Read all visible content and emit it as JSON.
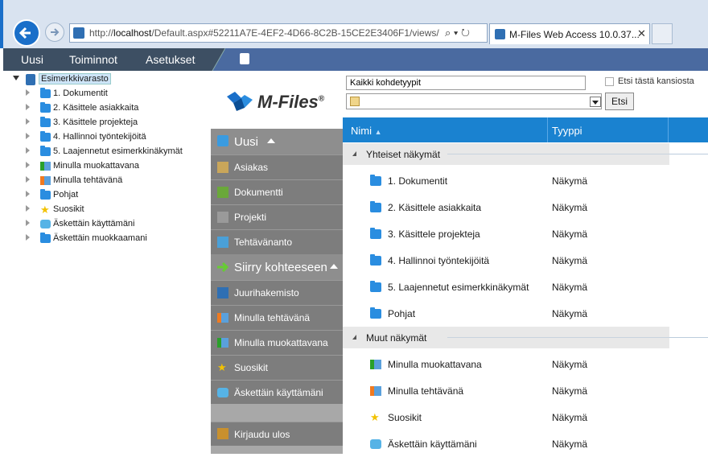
{
  "browser": {
    "address_prefix": "http://",
    "address_host": "localhost",
    "address_rest": "/Default.aspx#52211A7E-4EF2-4D66-8C2B-15CE2E3406F1/views/",
    "address_controls": "⌕ ▾ ↻",
    "tab_title": "M-Files Web Access 10.0.37...",
    "tab_close": "✕"
  },
  "menubar": {
    "items": [
      "Uusi",
      "Toiminnot",
      "Asetukset"
    ]
  },
  "tree": {
    "root": "Esimerkkivarasto",
    "items": [
      {
        "label": "1. Dokumentit",
        "icon": "folder-icon"
      },
      {
        "label": "2. Käsittele asiakkaita",
        "icon": "folder-icon"
      },
      {
        "label": "3. Käsittele projekteja",
        "icon": "folder-icon"
      },
      {
        "label": "4. Hallinnoi työntekijöitä",
        "icon": "folder-icon"
      },
      {
        "label": "5. Laajennetut esimerkkinäkymät",
        "icon": "folder-icon"
      },
      {
        "label": "Minulla muokattavana",
        "icon": "checked-out-icon"
      },
      {
        "label": "Minulla tehtävänä",
        "icon": "assigned-icon"
      },
      {
        "label": "Pohjat",
        "icon": "folder-icon"
      },
      {
        "label": "Suosikit",
        "icon": "star-icon"
      },
      {
        "label": "Äskettäin käyttämäni",
        "icon": "recent-icon"
      },
      {
        "label": "Äskettäin muokkaamani",
        "icon": "folder-icon"
      }
    ]
  },
  "logo": {
    "text": "M-Files",
    "mark": "®"
  },
  "taskpane": {
    "new_header": "Uusi",
    "new_items": [
      "Asiakas",
      "Dokumentti",
      "Projekti",
      "Tehtävänanto"
    ],
    "goto_header": "Siirry kohteeseen",
    "goto_items": [
      "Juurihakemisto",
      "Minulla tehtävänä",
      "Minulla muokattavana",
      "Suosikit",
      "Äskettäin käyttämäni"
    ],
    "logout": "Kirjaudu ulos"
  },
  "search": {
    "value": "Kaikki kohdetyypit",
    "in_folder_label": "Etsi tästä kansiosta",
    "button": "Etsi"
  },
  "grid": {
    "col_name": "Nimi",
    "col_type": "Tyyppi",
    "sections": [
      {
        "title": "Yhteiset näkymät",
        "rows": [
          {
            "name": "1. Dokumentit",
            "type": "Näkymä",
            "icon": "folder-icon"
          },
          {
            "name": "2. Käsittele asiakkaita",
            "type": "Näkymä",
            "icon": "folder-icon"
          },
          {
            "name": "3. Käsittele projekteja",
            "type": "Näkymä",
            "icon": "folder-icon"
          },
          {
            "name": "4. Hallinnoi työntekijöitä",
            "type": "Näkymä",
            "icon": "folder-icon"
          },
          {
            "name": "5. Laajennetut esimerkkinäkymät",
            "type": "Näkymä",
            "icon": "folder-icon"
          },
          {
            "name": "Pohjat",
            "type": "Näkymä",
            "icon": "folder-icon"
          }
        ]
      },
      {
        "title": "Muut näkymät",
        "rows": [
          {
            "name": "Minulla muokattavana",
            "type": "Näkymä",
            "icon": "checked-out-icon"
          },
          {
            "name": "Minulla tehtävänä",
            "type": "Näkymä",
            "icon": "assigned-icon"
          },
          {
            "name": "Suosikit",
            "type": "Näkymä",
            "icon": "star-icon"
          },
          {
            "name": "Äskettäin käyttämäni",
            "type": "Näkymä",
            "icon": "recent-icon"
          }
        ]
      }
    ]
  },
  "colors": {
    "accent": "#1a82d0",
    "menubar": "#3d4f63",
    "taskpane": "#7d7d7d"
  }
}
